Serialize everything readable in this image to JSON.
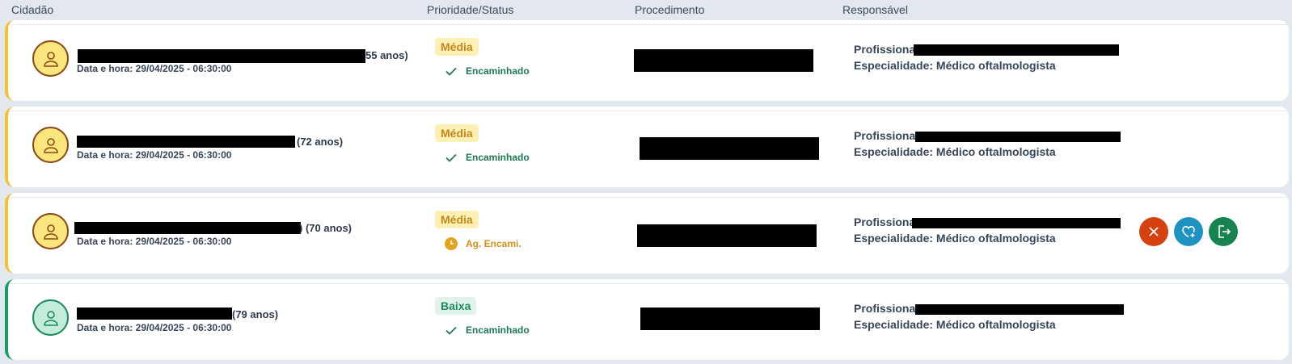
{
  "header": {
    "col_citizen": "Cidadão",
    "col_priority": "Prioridade/Status",
    "col_procedure": "Procedimento",
    "col_responsible": "Responsável"
  },
  "rows": [
    {
      "age": "55 anos)",
      "datetime": "Data e hora: 29/04/2025 - 06:30:00",
      "priority": "Média",
      "status": "Encaminhado",
      "professional_label": "Profissional:",
      "specialty": "Especialidade: Médico oftalmologista"
    },
    {
      "age": "(72 anos)",
      "datetime": "Data e hora: 29/04/2025 - 06:30:00",
      "priority": "Média",
      "status": "Encaminhado",
      "professional_label": "Profissional:",
      "specialty": "Especialidade: Médico oftalmologista"
    },
    {
      "age": ") (70 anos)",
      "datetime": "Data e hora: 29/04/2025 - 06:30:00",
      "priority": "Média",
      "status": "Ag. Encami.",
      "professional_label": "Profissional:",
      "specialty": "Especialidade: Médico oftalmologista"
    },
    {
      "age": "(79 anos)",
      "datetime": "Data e hora: 29/04/2025 - 06:30:00",
      "priority": "Baixa",
      "status": "Encaminhado",
      "professional_label": "Profissional:",
      "specialty": "Especialidade: Médico oftalmologista"
    }
  ],
  "row_icons": {
    "avatar": "user-icon",
    "status_done": "check-icon",
    "status_waiting": "clock-icon"
  },
  "actions": [
    {
      "name": "cancel",
      "icon": "close-icon",
      "color": "#d6410f"
    },
    {
      "name": "favorite",
      "icon": "heart-plus-icon",
      "color": "#1e93c2"
    },
    {
      "name": "exit",
      "icon": "exit-icon",
      "color": "#17834f"
    }
  ],
  "colors": {
    "medium_accent": "#f2c230",
    "low_accent": "#1b9a65",
    "medium_badge_bg": "#fdf0b5",
    "medium_badge_text": "#c7871d",
    "low_badge_bg": "#dff3ea",
    "low_badge_text": "#1e8a5a",
    "status_done": "#1c7a51",
    "status_waiting": "#d4901b"
  }
}
